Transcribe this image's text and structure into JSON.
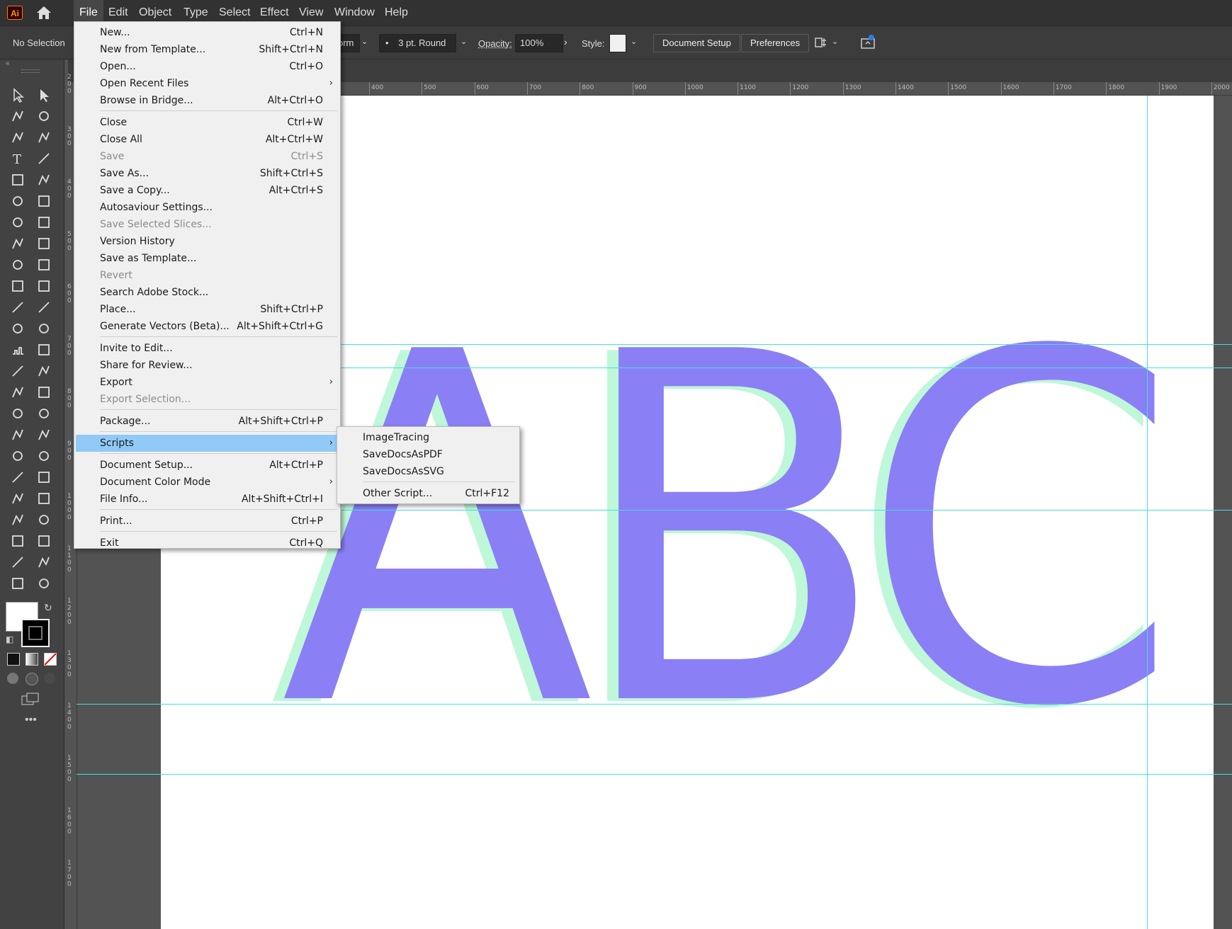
{
  "app": {
    "logo_text": "Ai"
  },
  "menubar": {
    "items": [
      "File",
      "Edit",
      "Object",
      "Type",
      "Select",
      "Effect",
      "View",
      "Window",
      "Help"
    ],
    "active": "File"
  },
  "controlbar": {
    "selection_status": "No Selection",
    "brush_partial": "orm",
    "stroke_profile": "3 pt. Round",
    "opacity_label": "Opacity:",
    "opacity_value": "100%",
    "style_label": "Style:",
    "document_setup_label": "Document Setup",
    "preferences_label": "Preferences"
  },
  "ruler": {
    "top_ticks": [
      "400",
      "500",
      "600",
      "700",
      "800",
      "900",
      "1000",
      "1100",
      "1200",
      "1300",
      "1400",
      "1500",
      "1600",
      "1700",
      "1800",
      "1900",
      "2000"
    ],
    "left_ticks": [
      "200",
      "300",
      "400",
      "500",
      "600",
      "700",
      "800",
      "900",
      "1000",
      "1100",
      "1200",
      "1300",
      "1400",
      "1500",
      "1600",
      "1700"
    ]
  },
  "artwork": {
    "text": "ABC",
    "fill_color": "#8b7ff5",
    "offset_color": "#bff7d9",
    "guide_color": "#3fe0e6"
  },
  "file_menu": {
    "items": [
      {
        "label": "New...",
        "shortcut": "Ctrl+N"
      },
      {
        "label": "New from Template...",
        "shortcut": "Shift+Ctrl+N"
      },
      {
        "label": "Open...",
        "shortcut": "Ctrl+O"
      },
      {
        "label": "Open Recent Files",
        "shortcut": "",
        "submenu": true
      },
      {
        "label": "Browse in Bridge...",
        "shortcut": "Alt+Ctrl+O"
      },
      {
        "label": "Close",
        "shortcut": "Ctrl+W"
      },
      {
        "label": "Close All",
        "shortcut": "Alt+Ctrl+W"
      },
      {
        "label": "Save",
        "shortcut": "Ctrl+S",
        "disabled": true
      },
      {
        "label": "Save As...",
        "shortcut": "Shift+Ctrl+S"
      },
      {
        "label": "Save a Copy...",
        "shortcut": "Alt+Ctrl+S"
      },
      {
        "label": "Autosaviour Settings...",
        "shortcut": ""
      },
      {
        "label": "Save Selected Slices...",
        "shortcut": "",
        "disabled": true
      },
      {
        "label": "Version History",
        "shortcut": ""
      },
      {
        "label": "Save as Template...",
        "shortcut": ""
      },
      {
        "label": "Revert",
        "shortcut": "",
        "disabled": true
      },
      {
        "label": "Search Adobe Stock...",
        "shortcut": ""
      },
      {
        "label": "Place...",
        "shortcut": "Shift+Ctrl+P"
      },
      {
        "label": "Generate Vectors (Beta)...",
        "shortcut": "Alt+Shift+Ctrl+G"
      },
      {
        "label": "Invite to Edit...",
        "shortcut": ""
      },
      {
        "label": "Share for Review...",
        "shortcut": ""
      },
      {
        "label": "Export",
        "shortcut": "",
        "submenu": true
      },
      {
        "label": "Export Selection...",
        "shortcut": "",
        "disabled": true
      },
      {
        "label": "Package...",
        "shortcut": "Alt+Shift+Ctrl+P"
      },
      {
        "label": "Scripts",
        "shortcut": "",
        "submenu": true,
        "highlighted": true
      },
      {
        "label": "Document Setup...",
        "shortcut": "Alt+Ctrl+P"
      },
      {
        "label": "Document Color Mode",
        "shortcut": "",
        "submenu": true
      },
      {
        "label": "File Info...",
        "shortcut": "Alt+Shift+Ctrl+I"
      },
      {
        "label": "Print...",
        "shortcut": "Ctrl+P"
      },
      {
        "label": "Exit",
        "shortcut": "Ctrl+Q"
      }
    ]
  },
  "scripts_menu": {
    "items": [
      {
        "label": "ImageTracing",
        "shortcut": ""
      },
      {
        "label": "SaveDocsAsPDF",
        "shortcut": ""
      },
      {
        "label": "SaveDocsAsSVG",
        "shortcut": ""
      },
      {
        "label": "Other Script...",
        "shortcut": "Ctrl+F12"
      }
    ]
  },
  "toolbar": {
    "more_label": "•••"
  }
}
